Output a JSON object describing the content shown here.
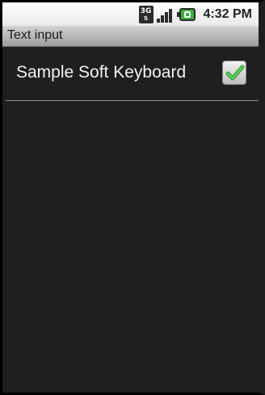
{
  "status_bar": {
    "network_type": "3G",
    "time": "4:32 PM",
    "icons": [
      "3g-network-icon",
      "signal-strength-icon",
      "battery-charging-icon"
    ]
  },
  "title_bar": {
    "title": "Text input"
  },
  "preferences": [
    {
      "label": "Sample Soft Keyboard",
      "checked": true
    }
  ],
  "colors": {
    "background": "#1f1f1f",
    "title_bar_top": "#d2d2d2",
    "title_bar_bottom": "#9e9e9e",
    "check_green": "#3cb043",
    "label_text": "#f2f2f2"
  }
}
